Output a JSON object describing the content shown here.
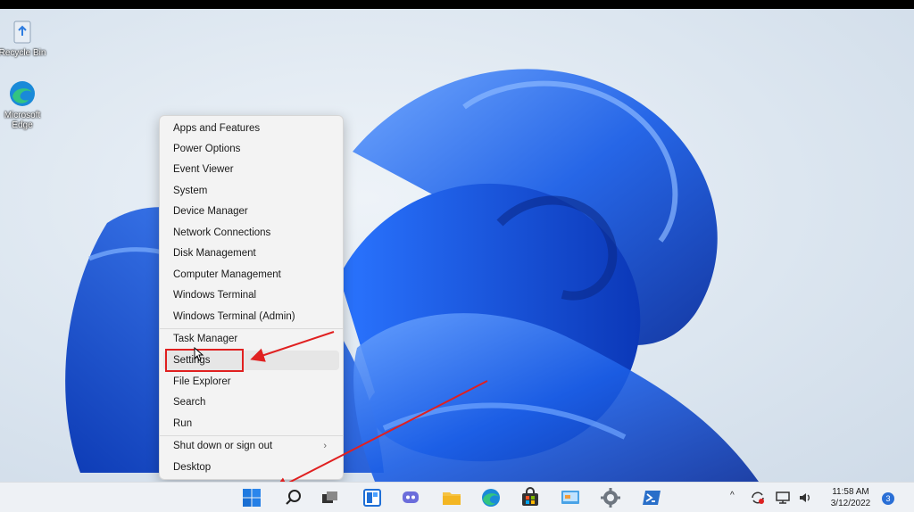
{
  "desktop": {
    "icons": [
      {
        "label": "Recycle Bin",
        "icon": "recycle-bin-icon"
      },
      {
        "label": "Microsoft Edge",
        "icon": "edge-icon"
      }
    ]
  },
  "context_menu": {
    "groups": [
      [
        "Apps and Features",
        "Power Options",
        "Event Viewer",
        "System",
        "Device Manager",
        "Network Connections",
        "Disk Management",
        "Computer Management",
        "Windows Terminal",
        "Windows Terminal (Admin)"
      ],
      [
        "Task Manager",
        "Settings",
        "File Explorer",
        "Search",
        "Run"
      ],
      [
        "Shut down or sign out",
        "Desktop"
      ]
    ],
    "submenu_arrow": "›"
  },
  "taskbar": {
    "apps": [
      "windows-start-icon",
      "search-icon",
      "task-view-icon",
      "widgets-icon",
      "chat-icon",
      "file-explorer-icon",
      "edge-icon",
      "store-icon",
      "control-panel-icon",
      "settings-gear-icon",
      "powershell-icon"
    ],
    "tray": {
      "chevron": "^",
      "time": "11:58 AM",
      "date": "3/12/2022",
      "notification_count": "3"
    }
  },
  "colors": {
    "accent_red": "#e02020",
    "wallpaper_blue": "#1a5ce0",
    "menu_bg": "#f3f3f3"
  }
}
